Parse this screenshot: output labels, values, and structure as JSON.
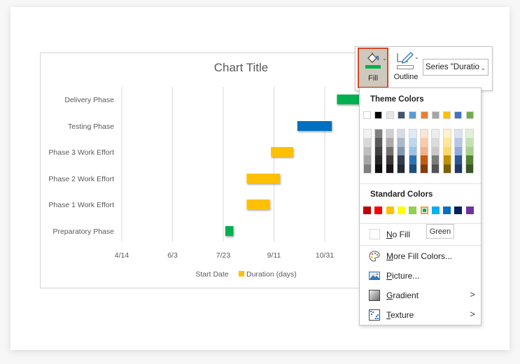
{
  "chart_data": {
    "type": "bar",
    "orientation": "horizontal-stacked-gantt",
    "title": "Chart Title",
    "categories": [
      "Preparatory Phase",
      "Phase 1 Work Effort",
      "Phase 2 Work Effort",
      "Phase 3 Work Effort",
      "Testing Phase",
      "Delivery Phase"
    ],
    "series": [
      {
        "name": "Start Date",
        "visible": false,
        "values_days_from_4_14": [
          102,
          123,
          123,
          147,
          173,
          212
        ]
      },
      {
        "name": "Duration (days)",
        "values": [
          8,
          23,
          33,
          22,
          34,
          22
        ]
      }
    ],
    "start_dates": [
      "7/25",
      "8/15",
      "8/15",
      "9/8",
      "10/4",
      "11/12"
    ],
    "bar_colors": [
      "#00b050",
      "#ffc000",
      "#ffc000",
      "#ffc000",
      "#0070c0",
      "#00b050"
    ],
    "x_tick_labels": [
      "4/14",
      "6/3",
      "7/23",
      "9/11",
      "10/31"
    ],
    "x_tick_offsets_days": [
      0,
      50,
      100,
      150,
      200
    ],
    "xlim_days": [
      0,
      250
    ],
    "grid": true,
    "legend": {
      "position": "bottom",
      "entries": [
        {
          "label": "Start Date",
          "color": null
        },
        {
          "label": "Duration (days)",
          "color": "#ffc000"
        }
      ]
    }
  },
  "toolbar": {
    "fill_label": "Fill",
    "outline_label": "Outline",
    "fill_color": "#00b050",
    "series_select_value": "Series \"Duratio"
  },
  "fill_menu": {
    "theme_colors_heading": "Theme Colors",
    "theme_colors": [
      "#ffffff",
      "#000000",
      "#e7e6e6",
      "#44546a",
      "#5b9bd5",
      "#ed7d31",
      "#a5a5a5",
      "#ffc000",
      "#4472c4",
      "#70ad47"
    ],
    "theme_shades": [
      [
        "#f2f2f2",
        "#d9d9d9",
        "#bfbfbf",
        "#a6a6a6",
        "#808080"
      ],
      [
        "#808080",
        "#595959",
        "#404040",
        "#262626",
        "#0d0d0d"
      ],
      [
        "#d0cece",
        "#aeaaaa",
        "#757171",
        "#3b3838",
        "#171616"
      ],
      [
        "#d6dce5",
        "#adb9ca",
        "#8497b0",
        "#333f50",
        "#222a35"
      ],
      [
        "#deebf7",
        "#bdd7ee",
        "#9dc3e6",
        "#2e75b6",
        "#1f4e79"
      ],
      [
        "#fbe5d6",
        "#f8cbad",
        "#f4b183",
        "#c55a11",
        "#843c0c"
      ],
      [
        "#ededed",
        "#dbdbdb",
        "#c9c9c9",
        "#7b7b7b",
        "#525252"
      ],
      [
        "#fff2cc",
        "#ffe699",
        "#ffd966",
        "#bf9000",
        "#7f6000"
      ],
      [
        "#dae3f3",
        "#b4c7e7",
        "#8faadc",
        "#2f5597",
        "#1f3864"
      ],
      [
        "#e2f0d9",
        "#c5e0b4",
        "#a9d18e",
        "#548235",
        "#385723"
      ]
    ],
    "standard_colors_heading": "Standard Colors",
    "standard_colors": [
      "#c00000",
      "#ff0000",
      "#ffc000",
      "#ffff00",
      "#92d050",
      "#00b050",
      "#00b0f0",
      "#0070c0",
      "#002060",
      "#7030a0"
    ],
    "selected_standard_color": "#00b050",
    "tooltip": "Green",
    "no_fill": {
      "accel": "N",
      "rest": "o Fill"
    },
    "more_fill_colors": {
      "accel": "M",
      "rest": "ore Fill Colors..."
    },
    "picture": {
      "accel": "P",
      "rest": "icture..."
    },
    "gradient": {
      "accel": "G",
      "rest": "radient"
    },
    "texture": {
      "accel": "T",
      "rest": "exture"
    },
    "submenu_arrow": ">"
  }
}
